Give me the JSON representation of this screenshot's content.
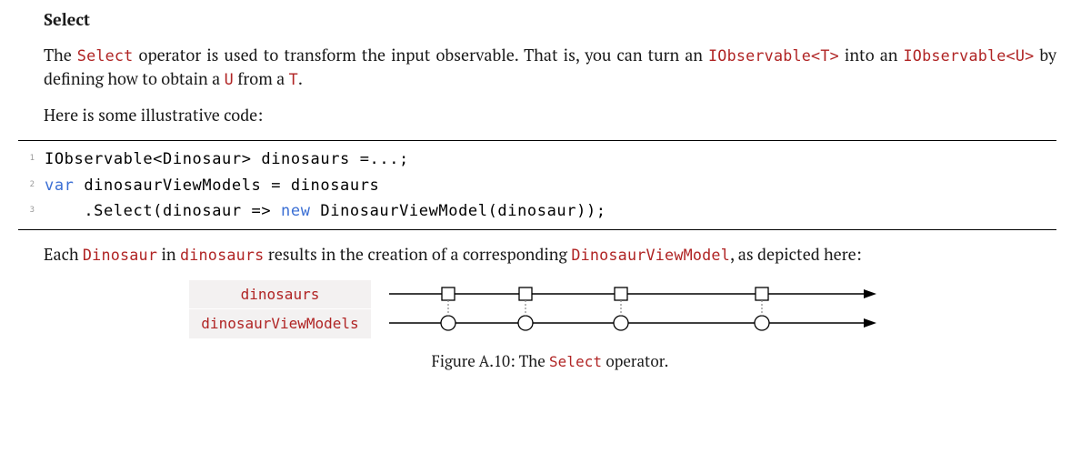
{
  "section": {
    "title": "Select"
  },
  "para1": {
    "t1": "The ",
    "c1": "Select",
    "t2": " operator is used to transform the input observable.  That is, you can turn an ",
    "c2": "IObservable<T>",
    "t3": " into an ",
    "c3": "IObservable<U>",
    "t4": " by defining how to obtain a ",
    "c4": "U",
    "t5": " from a ",
    "c5": "T",
    "t6": "."
  },
  "para2": "Here is some illustrative code:",
  "code": {
    "lines": [
      {
        "n": "1",
        "tokens": [
          {
            "t": "IObservable<Dinosaur> dinosaurs =...;",
            "c": "plain"
          }
        ]
      },
      {
        "n": "2",
        "tokens": [
          {
            "t": "var",
            "c": "kw"
          },
          {
            "t": " dinosaurViewModels = dinosaurs",
            "c": "plain"
          }
        ]
      },
      {
        "n": "3",
        "tokens": [
          {
            "t": "    .Select(dinosaur => ",
            "c": "plain"
          },
          {
            "t": "new",
            "c": "kw"
          },
          {
            "t": " DinosaurViewModel(dinosaur));",
            "c": "plain"
          }
        ]
      }
    ]
  },
  "para3": {
    "t1": "Each ",
    "c1": "Dinosaur",
    "t2": " in ",
    "c2": "dinosaurs",
    "t3": " results in the creation of a corresponding ",
    "c3": "DinosaurViewModel",
    "t4": ", as depicted here:"
  },
  "marble": {
    "rows": [
      {
        "label": "dinosaurs",
        "shape": "square"
      },
      {
        "label": "dinosaurViewModels",
        "shape": "circle"
      }
    ],
    "positions": [
      85,
      170,
      275,
      430
    ]
  },
  "figure": {
    "pre": "Figure A.10: The ",
    "code": "Select",
    "post": " operator."
  },
  "chart_data": {
    "type": "table",
    "title": "Figure A.10: The Select operator — marble diagram",
    "description": "Two synchronized timelines. The source 'dinosaurs' emits four items (squares); each maps via Select to one item on 'dinosaurViewModels' (circles) at the same instants.",
    "streams": [
      {
        "name": "dinosaurs",
        "marker": "square",
        "events_at": [
          1,
          2,
          3,
          4
        ]
      },
      {
        "name": "dinosaurViewModels",
        "marker": "circle",
        "events_at": [
          1,
          2,
          3,
          4
        ]
      }
    ],
    "mapping": "one-to-one"
  }
}
